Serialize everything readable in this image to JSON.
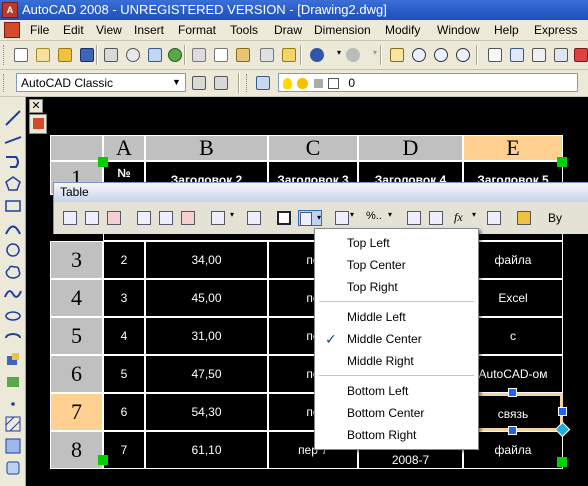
{
  "title_bar": {
    "app_icon": "autocad-logo-icon",
    "text": "AutoCAD 2008 - UNREGISTERED VERSION - [Drawing2.dwg]"
  },
  "menu": [
    "File",
    "Edit",
    "View",
    "Insert",
    "Format",
    "Tools",
    "Draw",
    "Dimension",
    "Modify",
    "Window",
    "Help",
    "Express"
  ],
  "workspace": {
    "value": "AutoCAD Classic"
  },
  "layer": {
    "value": "0"
  },
  "table_toolbar": {
    "title": "Table",
    "partial_label": "By"
  },
  "table": {
    "columns": [
      "A",
      "B",
      "C",
      "D",
      "E"
    ],
    "row_numbers": [
      "1",
      "3",
      "4",
      "5",
      "6",
      "7",
      "8"
    ],
    "header_row": {
      "a": "№",
      "b": "Заголовок 2",
      "c": "Заголовок 3",
      "d": "Заголовок 4",
      "e": "Заголовок 5"
    },
    "rows": [
      {
        "num": "3",
        "a": "2",
        "b": "34,00",
        "c": "пе",
        "e": "файла"
      },
      {
        "num": "4",
        "a": "3",
        "b": "45,00",
        "c": "пе",
        "e": "Excel"
      },
      {
        "num": "5",
        "a": "4",
        "b": "31,00",
        "c": "пе",
        "e": "с"
      },
      {
        "num": "6",
        "a": "5",
        "b": "47,50",
        "c": "пе",
        "e": "AutoCAD-ом"
      },
      {
        "num": "7",
        "a": "6",
        "b": "54,30",
        "c": "пе",
        "e": "связь"
      },
      {
        "num": "8",
        "a": "7",
        "b": "61,10",
        "c": "пер 7",
        "d": "2008-7",
        "e": "файла"
      }
    ]
  },
  "alignment_menu": {
    "items": [
      {
        "label": "Top Left",
        "checked": false
      },
      {
        "label": "Top Center",
        "checked": false
      },
      {
        "label": "Top Right",
        "checked": false
      },
      {
        "label": "Middle Left",
        "checked": false
      },
      {
        "label": "Middle Center",
        "checked": true
      },
      {
        "label": "Middle Right",
        "checked": false
      },
      {
        "label": "Bottom Left",
        "checked": false
      },
      {
        "label": "Bottom Center",
        "checked": false
      },
      {
        "label": "Bottom Right",
        "checked": false
      }
    ],
    "check_glyph": "✓"
  },
  "colors": {
    "title_bar": "#1d4fb8",
    "chrome": "#ece9d8",
    "canvas": "#000000",
    "selected_header": "#ffd090",
    "grip_green": "#00d000",
    "grip_blue": "#2060ff"
  }
}
